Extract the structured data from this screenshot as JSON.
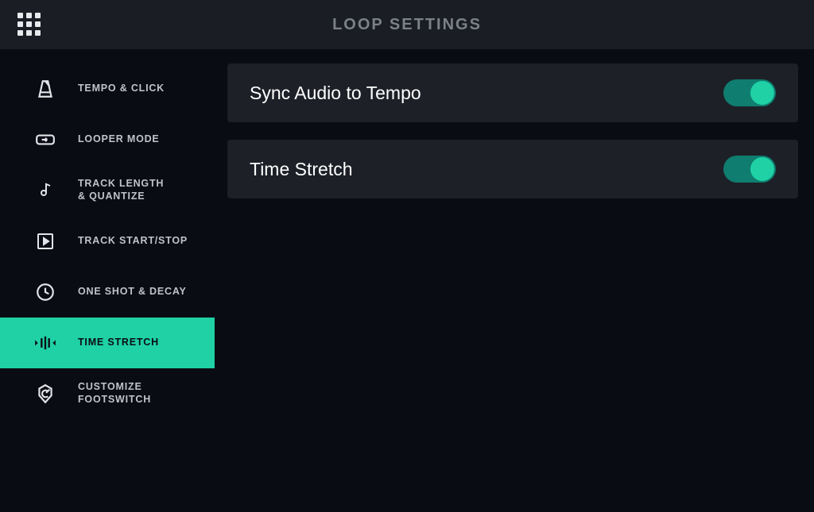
{
  "colors": {
    "accent": "#1fd1a5",
    "bg": "#0a0c13",
    "panel": "#1d2027",
    "header": "#1a1d24"
  },
  "header": {
    "title": "LOOP SETTINGS",
    "menu_icon": "grid-menu-icon"
  },
  "sidebar": {
    "items": [
      {
        "label": "TEMPO & CLICK",
        "icon": "metronome-icon",
        "active": false
      },
      {
        "label": "LOOPER MODE",
        "icon": "looper-icon",
        "active": false
      },
      {
        "label": "TRACK LENGTH\n& QUANTIZE",
        "icon": "note-icon",
        "active": false
      },
      {
        "label": "TRACK START/STOP",
        "icon": "play-box-icon",
        "active": false
      },
      {
        "label": "ONE SHOT & DECAY",
        "icon": "clock-icon",
        "active": false
      },
      {
        "label": "TIME STRETCH",
        "icon": "time-stretch-icon",
        "active": true
      },
      {
        "label": "CUSTOMIZE\nFOOTSWITCH",
        "icon": "footswitch-icon",
        "active": false
      }
    ]
  },
  "settings": [
    {
      "label": "Sync Audio to Tempo",
      "enabled": true
    },
    {
      "label": "Time Stretch",
      "enabled": true
    }
  ]
}
